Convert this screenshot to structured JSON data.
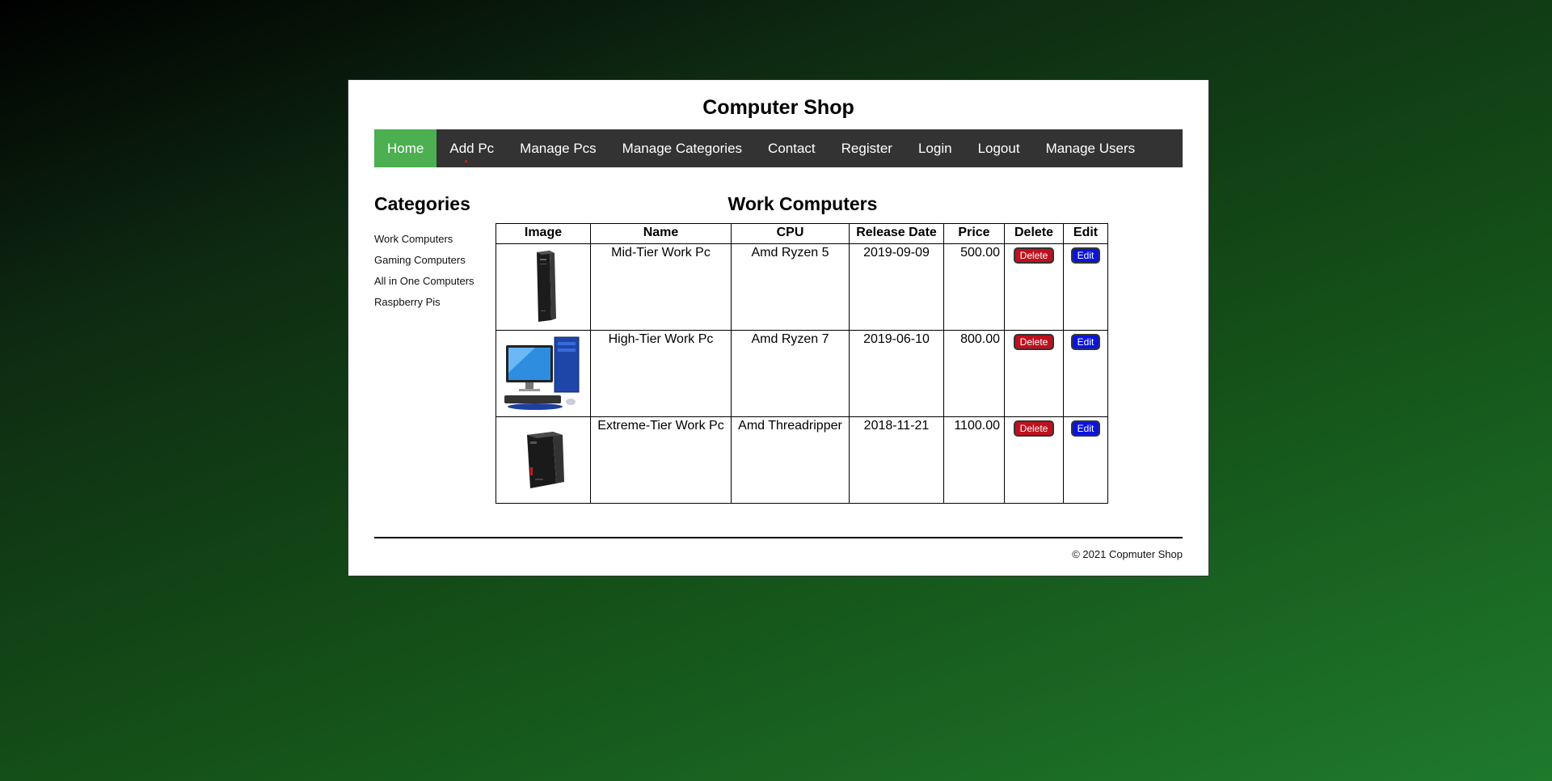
{
  "site": {
    "title": "Computer Shop"
  },
  "nav": {
    "items": [
      {
        "label": "Home",
        "active": true
      },
      {
        "label": "Add Pc"
      },
      {
        "label": "Manage Pcs"
      },
      {
        "label": "Manage Categories"
      },
      {
        "label": "Contact"
      },
      {
        "label": "Register"
      },
      {
        "label": "Login"
      },
      {
        "label": "Logout"
      },
      {
        "label": "Manage Users"
      }
    ],
    "active_color": "#4caf50",
    "bar_color": "#333333"
  },
  "sidebar": {
    "heading": "Categories",
    "categories": [
      "Work Computers",
      "Gaming Computers",
      "All in One Computers",
      "Raspberry Pis"
    ]
  },
  "main": {
    "heading": "Work Computers",
    "columns": [
      "Image",
      "Name",
      "CPU",
      "Release Date",
      "Price",
      "Delete",
      "Edit"
    ],
    "rows": [
      {
        "image": "slim-tower-pc-image",
        "name": "Mid-Tier Work Pc",
        "cpu": "Amd Ryzen 5",
        "release_date": "2019-09-09",
        "price": "500.00",
        "delete_label": "Delete",
        "edit_label": "Edit"
      },
      {
        "image": "desktop-pc-with-monitor-image",
        "name": "High-Tier Work Pc",
        "cpu": "Amd Ryzen 7",
        "release_date": "2019-06-10",
        "price": "800.00",
        "delete_label": "Delete",
        "edit_label": "Edit"
      },
      {
        "image": "small-form-factor-pc-image",
        "name": "Extreme-Tier Work Pc",
        "cpu": "Amd Threadripper",
        "release_date": "2018-11-21",
        "price": "1100.00",
        "delete_label": "Delete",
        "edit_label": "Edit"
      }
    ],
    "delete_color": "#c0101e",
    "edit_color": "#0a14e0"
  },
  "footer": {
    "text": "© 2021 Copmuter Shop"
  }
}
